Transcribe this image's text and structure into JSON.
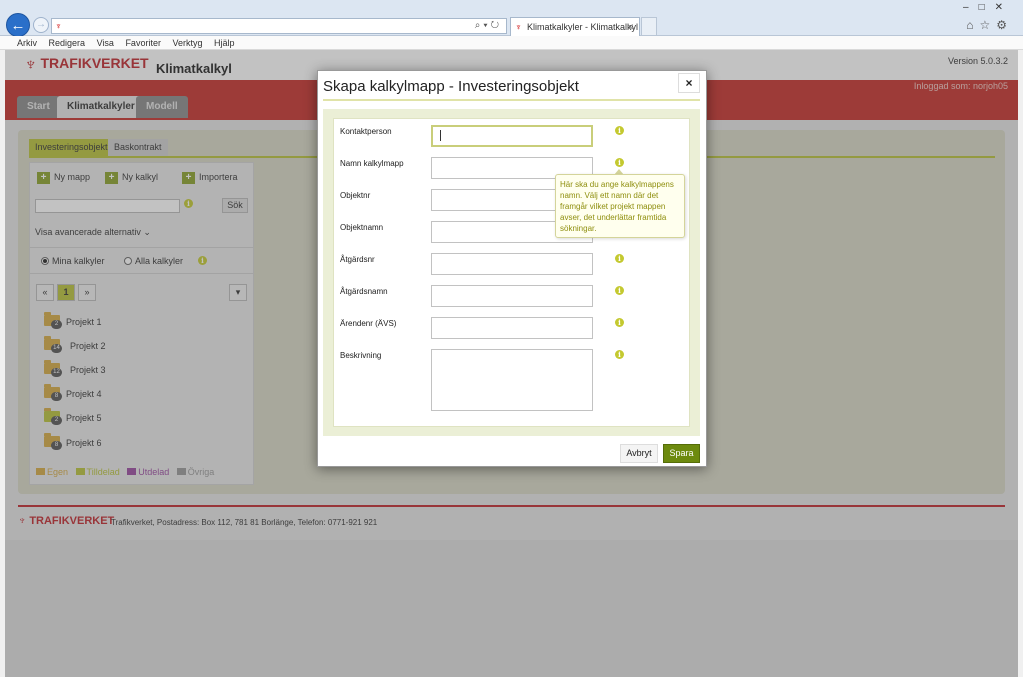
{
  "browser": {
    "address": "",
    "tab_title": "Klimatkalkyler - Klimatkalkyl",
    "menu": [
      "Arkiv",
      "Redigera",
      "Visa",
      "Favoriter",
      "Verktyg",
      "Hjälp"
    ]
  },
  "app": {
    "logo_text": "TRAFIKVERKET",
    "title": "Klimatkalkyl",
    "version": "Version 5.0.3.2",
    "logged_in": "Inloggad som: norjoh05",
    "nav_tabs": [
      "Start",
      "Klimatkalkyler",
      "Modell"
    ],
    "active_nav_tab": "Klimatkalkyler"
  },
  "sidebar": {
    "tabs": [
      "Investeringsobjekt",
      "Baskontrakt"
    ],
    "actions": [
      "Ny mapp",
      "Ny kalkyl",
      "Importera"
    ],
    "search_button": "Sök",
    "advanced": "Visa avancerade alternativ",
    "radio_mine": "Mina kalkyler",
    "radio_all": "Alla kalkyler",
    "selected_radio": "Mina kalkyler",
    "pagination": {
      "prev": "«",
      "current": "1",
      "next": "»"
    },
    "folders": [
      {
        "name": "Projekt 1",
        "count": "2"
      },
      {
        "name": "Projekt 2",
        "count": "14"
      },
      {
        "name": "Projekt 3",
        "count": "12"
      },
      {
        "name": "Projekt 4",
        "count": "8"
      },
      {
        "name": "Projekt 5",
        "count": "2"
      },
      {
        "name": "Projekt 6",
        "count": "8"
      }
    ],
    "legend": [
      {
        "label": "Egen",
        "color": "#d4a942"
      },
      {
        "label": "Tilldelad",
        "color": "#b8c23a"
      },
      {
        "label": "Utdelad",
        "color": "#9a4aa0"
      },
      {
        "label": "Övriga",
        "color": "#999999"
      }
    ]
  },
  "footer": {
    "logo_text": "TRAFIKVERKET",
    "address": "Trafikverket, Postadress: Box 112, 781 81 Borlänge, Telefon: 0771-921 921"
  },
  "modal": {
    "title": "Skapa kalkylmapp - Investeringsobjekt",
    "close": "×",
    "fields": [
      {
        "label": "Kontaktperson",
        "value": ""
      },
      {
        "label": "Namn kalkylmapp",
        "value": ""
      },
      {
        "label": "Objektnr",
        "value": ""
      },
      {
        "label": "Objektnamn",
        "value": ""
      },
      {
        "label": "Åtgärdsnr",
        "value": ""
      },
      {
        "label": "Åtgärdsnamn",
        "value": ""
      },
      {
        "label": "Ärendenr (ÄVS)",
        "value": ""
      },
      {
        "label": "Beskrivning",
        "value": ""
      }
    ],
    "tooltip": "Här ska du ange kalkylmappens namn. Välj ett namn där det framgår vilket projekt mappen avser, det underlättar framtida sökningar.",
    "cancel_label": "Avbryt",
    "save_label": "Spara"
  },
  "colors": {
    "brand_red": "#c0272d",
    "accent_green": "#b8c23a",
    "save_green": "#6d8a0e"
  }
}
